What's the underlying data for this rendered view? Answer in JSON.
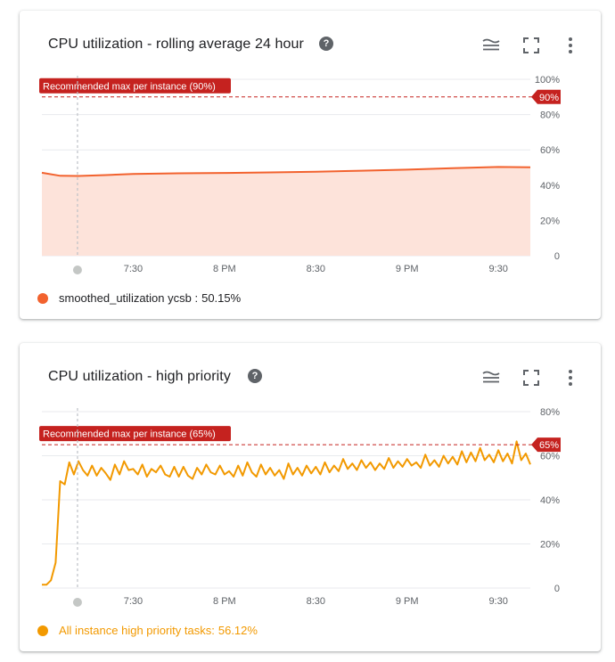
{
  "colors": {
    "card1_series": "#f2622e",
    "card1_fill": "#fde3da",
    "card2_series": "#f29900",
    "threshold": "#c5221f",
    "grid": "#e8eaed",
    "axis_text": "#5f6368"
  },
  "icons": [
    "help-icon",
    "legend-toggle-icon",
    "fullscreen-icon",
    "more-vert-icon"
  ],
  "card1": {
    "title": "CPU utilization - rolling average 24 hour",
    "help_glyph": "?",
    "threshold_label": "Recommended max per instance (90%)",
    "threshold_tag": "90%",
    "legend_name": "smoothed_utilization ycsb :",
    "legend_value": "50.15%"
  },
  "card2": {
    "title": "CPU utilization - high priority",
    "help_glyph": "?",
    "threshold_label": "Recommended max per instance (65%)",
    "threshold_tag": "65%",
    "legend_name": "All instance high priority tasks:",
    "legend_value": "56.12%"
  },
  "chart_data": [
    {
      "type": "area",
      "title": "CPU utilization - rolling average 24 hour",
      "x_ticks": [
        "7:30",
        "8 PM",
        "8:30",
        "9 PM",
        "9:30"
      ],
      "x_tick_positions": [
        0.2,
        0.4,
        0.6,
        0.8,
        1.0
      ],
      "y_ticks": [
        "0",
        "20%",
        "40%",
        "60%",
        "80%",
        "100%"
      ],
      "y_tick_values": [
        0,
        20,
        40,
        60,
        80,
        100
      ],
      "ylim": [
        0,
        100
      ],
      "unit": "%",
      "threshold": 90,
      "cursor_x": 0.078,
      "series": [
        {
          "name": "smoothed_utilization ycsb",
          "last_value": 50.15,
          "points": [
            [
              0,
              47.0
            ],
            [
              0.04,
              45.3
            ],
            [
              0.08,
              45.2
            ],
            [
              0.14,
              45.7
            ],
            [
              0.2,
              46.3
            ],
            [
              0.3,
              46.7
            ],
            [
              0.4,
              46.9
            ],
            [
              0.5,
              47.2
            ],
            [
              0.6,
              47.6
            ],
            [
              0.7,
              48.2
            ],
            [
              0.8,
              48.8
            ],
            [
              0.9,
              49.6
            ],
            [
              1.0,
              50.3
            ],
            [
              1.07,
              50.1
            ]
          ]
        }
      ]
    },
    {
      "type": "line",
      "title": "CPU utilization - high priority",
      "x_ticks": [
        "7:30",
        "8 PM",
        "8:30",
        "9 PM",
        "9:30"
      ],
      "x_tick_positions": [
        0.2,
        0.4,
        0.6,
        0.8,
        1.0
      ],
      "y_ticks": [
        "0",
        "20%",
        "40%",
        "60%",
        "80%"
      ],
      "y_tick_values": [
        0,
        20,
        40,
        60,
        80
      ],
      "ylim": [
        0,
        80
      ],
      "unit": "%",
      "threshold": 65,
      "cursor_x": 0.078,
      "series": [
        {
          "name": "All instance high priority tasks",
          "last_value": 56.12,
          "points": [
            [
              0.0,
              1.5
            ],
            [
              0.01,
              1.5
            ],
            [
              0.02,
              3.5
            ],
            [
              0.03,
              11.5
            ],
            [
              0.04,
              48.5
            ],
            [
              0.05,
              47.0
            ],
            [
              0.06,
              57.0
            ],
            [
              0.07,
              51.5
            ],
            [
              0.08,
              57.5
            ],
            [
              0.09,
              53.5
            ],
            [
              0.1,
              51.0
            ],
            [
              0.11,
              55.5
            ],
            [
              0.12,
              51.0
            ],
            [
              0.13,
              54.5
            ],
            [
              0.14,
              52.0
            ],
            [
              0.15,
              49.0
            ],
            [
              0.16,
              56.0
            ],
            [
              0.17,
              51.5
            ],
            [
              0.18,
              57.5
            ],
            [
              0.19,
              53.5
            ],
            [
              0.2,
              54.0
            ],
            [
              0.21,
              51.5
            ],
            [
              0.22,
              56.0
            ],
            [
              0.23,
              50.5
            ],
            [
              0.24,
              54.0
            ],
            [
              0.25,
              52.5
            ],
            [
              0.26,
              55.5
            ],
            [
              0.27,
              51.5
            ],
            [
              0.28,
              50.5
            ],
            [
              0.29,
              55.0
            ],
            [
              0.3,
              50.5
            ],
            [
              0.31,
              55.0
            ],
            [
              0.32,
              51.0
            ],
            [
              0.33,
              49.5
            ],
            [
              0.34,
              54.5
            ],
            [
              0.35,
              51.5
            ],
            [
              0.36,
              56.0
            ],
            [
              0.37,
              52.5
            ],
            [
              0.38,
              51.5
            ],
            [
              0.39,
              55.5
            ],
            [
              0.4,
              51.5
            ],
            [
              0.41,
              53.0
            ],
            [
              0.42,
              50.5
            ],
            [
              0.43,
              55.5
            ],
            [
              0.44,
              51.0
            ],
            [
              0.45,
              57.0
            ],
            [
              0.46,
              52.5
            ],
            [
              0.47,
              50.5
            ],
            [
              0.48,
              56.0
            ],
            [
              0.49,
              51.5
            ],
            [
              0.5,
              54.5
            ],
            [
              0.51,
              51.0
            ],
            [
              0.52,
              53.5
            ],
            [
              0.53,
              49.5
            ],
            [
              0.54,
              56.5
            ],
            [
              0.55,
              51.5
            ],
            [
              0.56,
              54.5
            ],
            [
              0.57,
              51.0
            ],
            [
              0.58,
              55.5
            ],
            [
              0.59,
              52.0
            ],
            [
              0.6,
              55.0
            ],
            [
              0.61,
              51.5
            ],
            [
              0.62,
              57.0
            ],
            [
              0.63,
              52.5
            ],
            [
              0.64,
              55.5
            ],
            [
              0.65,
              53.0
            ],
            [
              0.66,
              58.5
            ],
            [
              0.67,
              54.0
            ],
            [
              0.68,
              56.5
            ],
            [
              0.69,
              53.5
            ],
            [
              0.7,
              58.0
            ],
            [
              0.71,
              54.5
            ],
            [
              0.72,
              57.0
            ],
            [
              0.73,
              53.5
            ],
            [
              0.74,
              56.5
            ],
            [
              0.75,
              54.0
            ],
            [
              0.76,
              59.0
            ],
            [
              0.77,
              54.5
            ],
            [
              0.78,
              57.5
            ],
            [
              0.79,
              55.0
            ],
            [
              0.8,
              58.5
            ],
            [
              0.81,
              55.5
            ],
            [
              0.82,
              57.0
            ],
            [
              0.83,
              54.5
            ],
            [
              0.84,
              60.5
            ],
            [
              0.85,
              55.5
            ],
            [
              0.86,
              58.0
            ],
            [
              0.87,
              55.0
            ],
            [
              0.88,
              60.0
            ],
            [
              0.89,
              56.5
            ],
            [
              0.9,
              59.5
            ],
            [
              0.91,
              56.0
            ],
            [
              0.92,
              62.0
            ],
            [
              0.93,
              57.0
            ],
            [
              0.94,
              61.5
            ],
            [
              0.95,
              57.5
            ],
            [
              0.96,
              63.5
            ],
            [
              0.97,
              58.0
            ],
            [
              0.98,
              60.5
            ],
            [
              0.99,
              57.0
            ],
            [
              1.0,
              62.5
            ],
            [
              1.01,
              57.5
            ],
            [
              1.02,
              61.0
            ],
            [
              1.03,
              56.5
            ],
            [
              1.04,
              66.5
            ],
            [
              1.05,
              58.0
            ],
            [
              1.06,
              61.0
            ],
            [
              1.07,
              56.1
            ]
          ]
        }
      ]
    }
  ]
}
